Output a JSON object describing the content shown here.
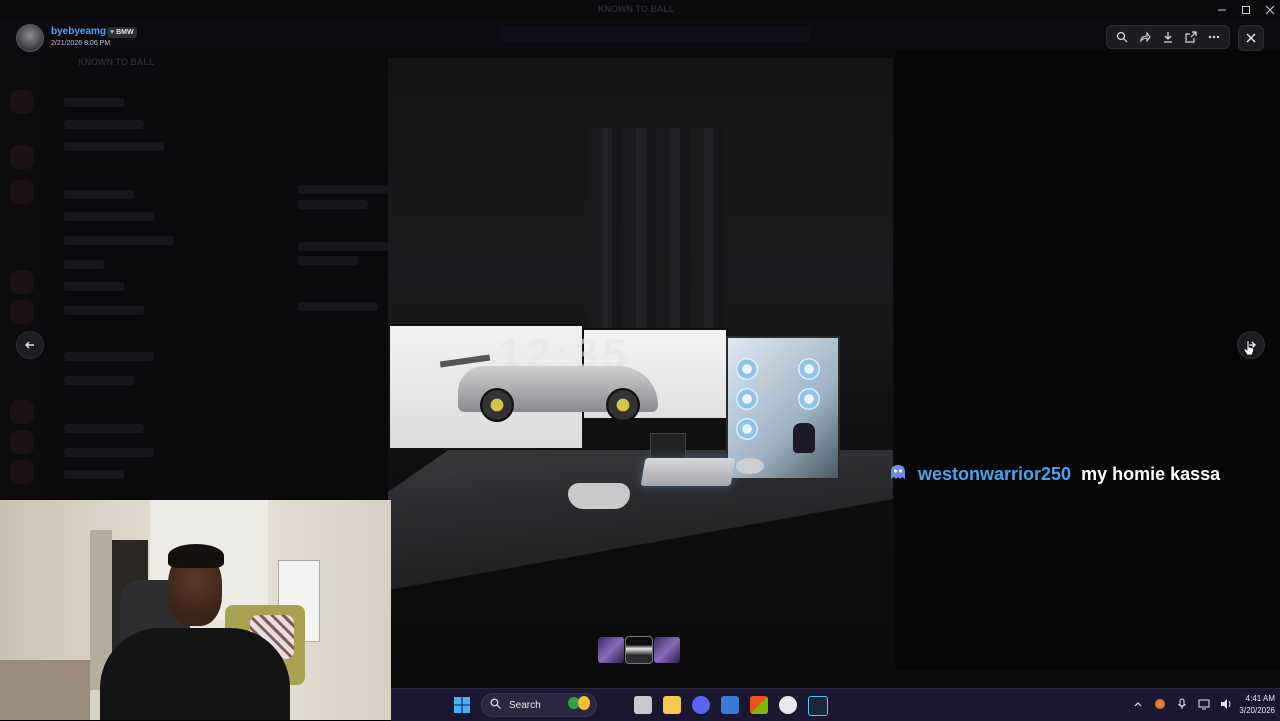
{
  "window": {
    "title": "KNOWN TO BALL"
  },
  "sender": {
    "name": "byebyeamg",
    "badge": "BMW",
    "date": "2/21/2026 8:06 PM"
  },
  "server": {
    "name": "KNOWN TO BALL"
  },
  "toolbar": {
    "icons": [
      "zoom-icon",
      "forward-icon",
      "download-icon",
      "open-external-icon",
      "more-icon"
    ]
  },
  "viewer": {
    "clock_text": "12:35"
  },
  "chat_overlay": {
    "username": "westonwarrior250",
    "message": "my homie kassa"
  },
  "taskbar": {
    "search_placeholder": "Search",
    "time": "4:41 AM",
    "date": "3/20/2026"
  },
  "colors": {
    "username_blue": "#4aa3ee",
    "taskbar_bg": "#1b1730"
  }
}
